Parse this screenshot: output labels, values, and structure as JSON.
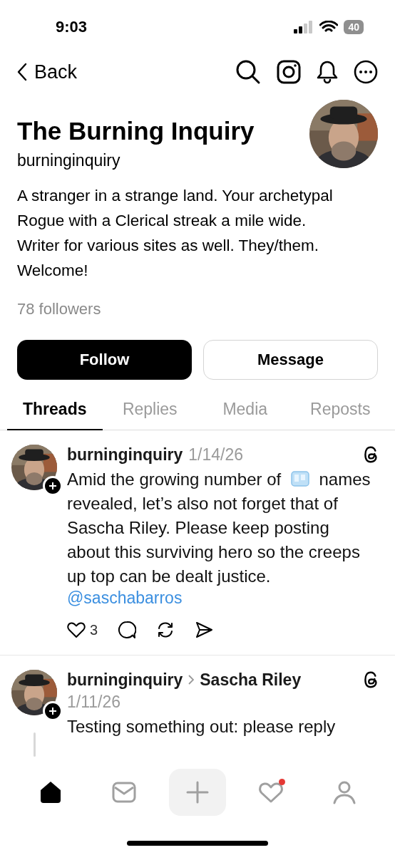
{
  "status_bar": {
    "time": "9:03",
    "battery": "40"
  },
  "nav": {
    "back": "Back"
  },
  "profile": {
    "name": "The Burning Inquiry",
    "handle": "burninginquiry",
    "bio": "A stranger in a strange land. Your archetypal Rogue with a Clerical streak a mile wide. Writer for various sites as well. They/them. Welcome!",
    "followers": "78 followers"
  },
  "buttons": [
    {
      "label": "Follow",
      "kind": "primary"
    },
    {
      "label": "Message",
      "kind": "secondary"
    }
  ],
  "tabs": [
    {
      "label": "Threads",
      "selected": true
    },
    {
      "label": "Replies",
      "selected": false
    },
    {
      "label": "Media",
      "selected": false
    },
    {
      "label": "Reposts",
      "selected": false
    }
  ],
  "posts": [
    {
      "author": "burninginquiry",
      "date": "1/14/26",
      "body_before": "Amid the growing number of",
      "body_after": "names revealed, let’s also not forget that of Sascha Riley. Please keep posting about this surviving hero so the creeps up top can be dealt justice.",
      "mention": "@saschabarros",
      "likes": "3",
      "thread_line": false
    },
    {
      "author": "burninginquiry",
      "reply_to": "Sascha Riley",
      "date": "1/11/26",
      "body_before": "Testing something out: please reply",
      "thread_line": true
    }
  ],
  "tab_bar": [
    {
      "kind": "home",
      "selected": true,
      "badge": false
    },
    {
      "kind": "inbox",
      "selected": false,
      "badge": false
    },
    {
      "kind": "create",
      "selected": false,
      "badge": false
    },
    {
      "kind": "activity",
      "selected": false,
      "badge": true
    },
    {
      "kind": "profile",
      "selected": false,
      "badge": false
    }
  ]
}
